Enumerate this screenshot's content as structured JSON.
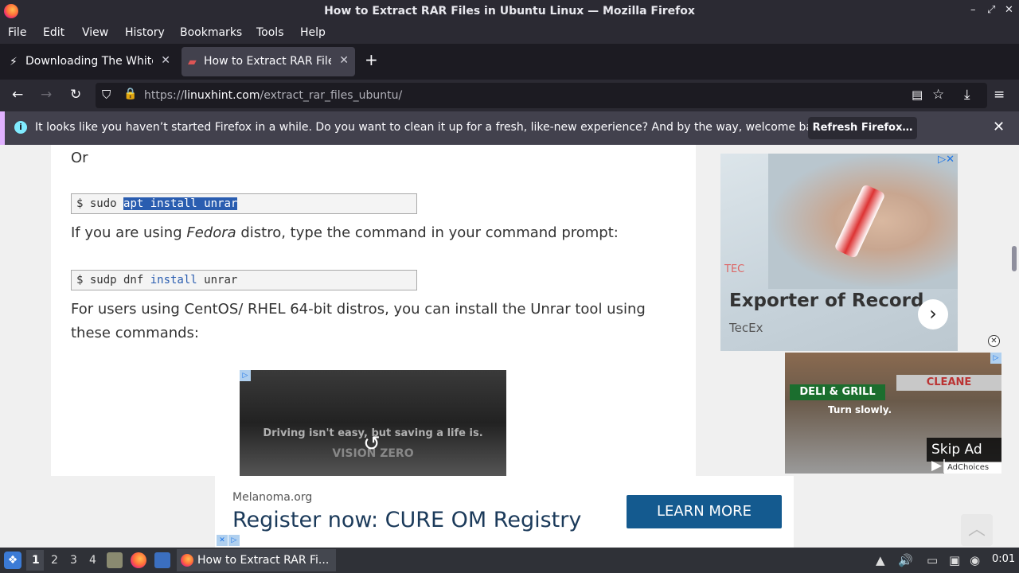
{
  "window": {
    "title": "How to Extract RAR Files in Ubuntu Linux — Mozilla Firefox",
    "controls": [
      "–",
      "⤢",
      "✕"
    ]
  },
  "menu": {
    "items": [
      "File",
      "Edit",
      "View",
      "History",
      "Bookmarks",
      "Tools",
      "Help"
    ]
  },
  "tabs": [
    {
      "label": "Downloading The White H",
      "active": false
    },
    {
      "label": "How to Extract RAR Files",
      "active": true
    }
  ],
  "nav": {
    "url_prefix": "https://",
    "url_domain": "linuxhint.com",
    "url_path": "/extract_rar_files_ubuntu/"
  },
  "notification": {
    "message": "It looks like you haven’t started Firefox in a while. Do you want to clean it up for a fresh, like-new experience? And by the way, welcome back!",
    "button": "Refresh Firefox…"
  },
  "article": {
    "or": "Or",
    "code1_prompt": "$ sudo ",
    "code1_selected": "apt install unrar",
    "fedora_pre": "If you are using ",
    "fedora_em": "Fedora",
    "fedora_post": " distro, type the command in your command prompt:",
    "code2_prompt": "$ sudp dnf ",
    "code2_kw": "install",
    "code2_rest": " unrar",
    "centos_line1": "For users using CentOS/ RHEL 64-bit distros, you can install the Unrar tool using",
    "centos_line2": "these commands:",
    "video_caption": "Driving isn't easy, but saving a life is.",
    "video_brand": "VISION ZERO"
  },
  "side_ad": {
    "headline": "Exporter of Record",
    "brand": "TecEx",
    "logo": "TEC"
  },
  "video_ad": {
    "sign_left": "DELI & GRILL",
    "sign_right": "CLEANE",
    "overlay": "Turn slowly.",
    "skip": "Skip Ad",
    "adchoices": "AdChoices"
  },
  "bottom_ad": {
    "org": "Melanoma.org",
    "headline": "Register now: CURE OM Registry",
    "cta": "LEARN MORE"
  },
  "taskbar": {
    "workspaces": [
      "1",
      "2",
      "3",
      "4"
    ],
    "active_app": "How to Extract RAR Fi...",
    "clock": "0:01"
  }
}
